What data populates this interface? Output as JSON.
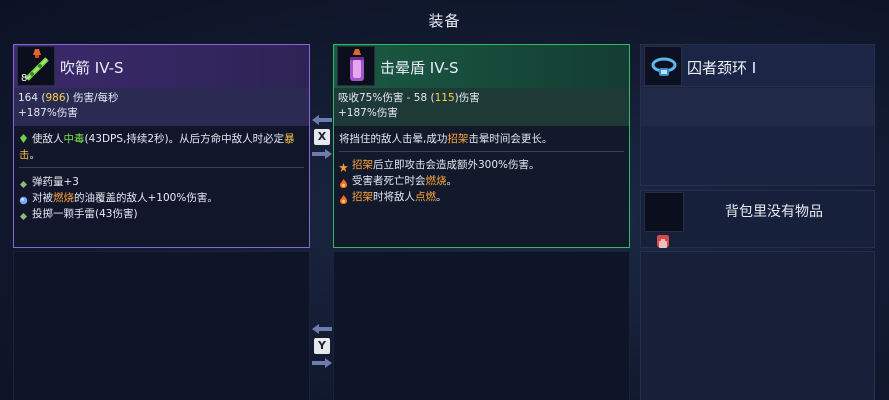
{
  "header": {
    "title": "装备"
  },
  "weapon1": {
    "name": "吹箭 IV-S",
    "level": "8",
    "stat_line1_prefix": "164 (",
    "stat_line1_value": "986",
    "stat_line1_suffix": ") 伤害/每秒",
    "stat_line2": "+187%伤害",
    "desc_a": "使敌人",
    "desc_poison": "中毒",
    "desc_b": "(43DPS,持续2秒)。从后方命中敌人时必定",
    "desc_crit": "暴击",
    "desc_end": "。",
    "mods": [
      {
        "pre": "弹药量+3",
        "kw": "",
        "post": ""
      },
      {
        "pre": "对被",
        "kw": "燃烧",
        "post": "的油覆盖的敌人+100%伤害。"
      },
      {
        "pre": "投掷一颗手雷(43伤害)",
        "kw": "",
        "post": ""
      }
    ],
    "accent": "#8b64d6"
  },
  "weapon2": {
    "name": "击晕盾 IV-S",
    "stat_line1_prefix": "吸收75%伤害 - 58 (",
    "stat_line1_value": "115",
    "stat_line1_suffix": ")伤害",
    "stat_line2": "+187%伤害",
    "desc_a": "将挡住的敌人击晕,成功",
    "desc_parry": "招架",
    "desc_b": "击晕时间会更长。",
    "mods": [
      {
        "kw1": "招架",
        "post1": "后立即攻击会造成额外300%伤害。",
        "kw2": "",
        "post2": ""
      },
      {
        "kw1": "",
        "post1": "受害者死亡时会",
        "kw2": "燃烧",
        "post2": "。"
      },
      {
        "kw1": "招架",
        "post1": "时将敌人",
        "kw2": "点燃",
        "post2": "。"
      }
    ],
    "accent": "#35b866"
  },
  "swap": {
    "key_x": "X",
    "key_y": "Y"
  },
  "amulet": {
    "name": "囚者颈环 I"
  },
  "backpack": {
    "empty_text": "背包里没有物品"
  }
}
